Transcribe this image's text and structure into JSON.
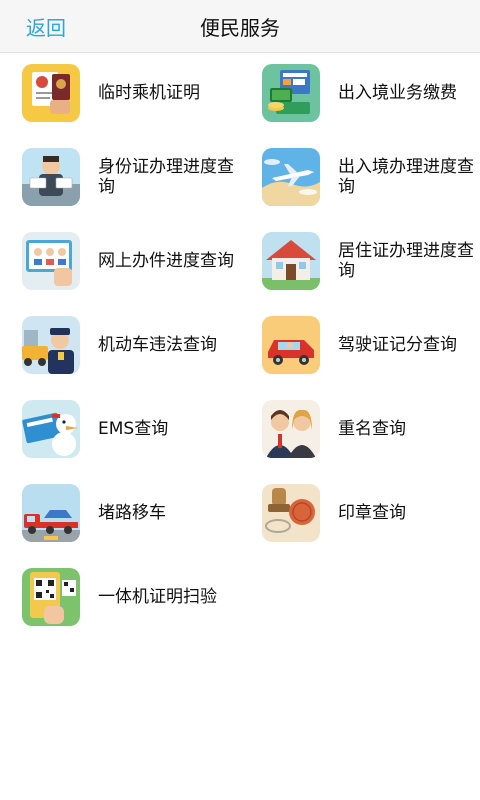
{
  "header": {
    "back_label": "返回",
    "title": "便民服务"
  },
  "items": [
    {
      "label": "临时乘机证明",
      "icon": "boarding-certificate-icon"
    },
    {
      "label": "出入境业务缴费",
      "icon": "payment-icon"
    },
    {
      "label": "身份证办理进度查询",
      "icon": "id-card-icon"
    },
    {
      "label": "出入境办理进度查询",
      "icon": "airplane-icon"
    },
    {
      "label": "网上办件进度查询",
      "icon": "online-service-icon"
    },
    {
      "label": "居住证办理进度查询",
      "icon": "house-icon"
    },
    {
      "label": "机动车违法查询",
      "icon": "police-icon"
    },
    {
      "label": "驾驶证记分查询",
      "icon": "car-icon"
    },
    {
      "label": "EMS查询",
      "icon": "ems-icon"
    },
    {
      "label": "重名查询",
      "icon": "people-icon"
    },
    {
      "label": "堵路移车",
      "icon": "tow-truck-icon"
    },
    {
      "label": "印章查询",
      "icon": "stamp-icon"
    },
    {
      "label": "一体机证明扫验",
      "icon": "qr-scan-icon"
    }
  ]
}
